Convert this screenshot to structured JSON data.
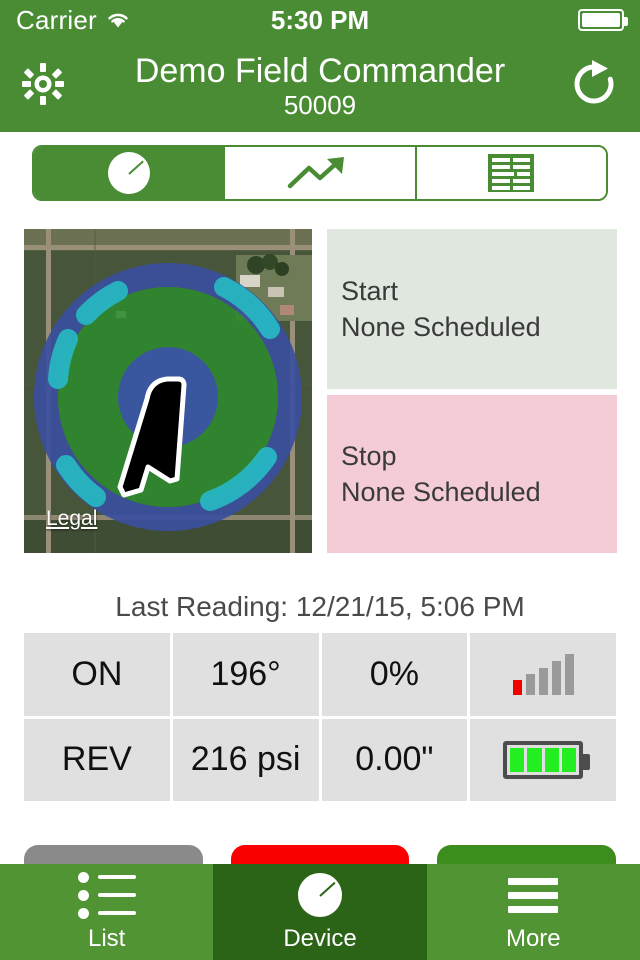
{
  "status_bar": {
    "carrier": "Carrier",
    "time": "5:30 PM",
    "wifi_icon": "wifi-icon",
    "battery_icon": "battery-full-icon"
  },
  "navbar": {
    "settings_icon": "gear-icon",
    "title": "Demo Field Commander",
    "subtitle": "50009",
    "refresh_icon": "refresh-icon"
  },
  "segmented_control": {
    "tabs": [
      {
        "name": "gauge",
        "icon": "gauge-icon",
        "selected": true
      },
      {
        "name": "trend",
        "icon": "trend-arrow-icon",
        "selected": false
      },
      {
        "name": "table",
        "icon": "table-icon",
        "selected": false
      }
    ]
  },
  "map": {
    "legal_label": "Legal",
    "overlay": {
      "outer_ring_color": "#3b4fa0",
      "field_color": "#2e8a2e",
      "inner_circle_color": "#3b52a8",
      "arc_color": "#27b6c2",
      "pivot_arm_color": "#000000",
      "pivot_arm_outline": "#ffffff"
    }
  },
  "schedule": {
    "start": {
      "title": "Start",
      "value": "None Scheduled",
      "bg_color": "#dfe7df"
    },
    "stop": {
      "title": "Stop",
      "value": "None Scheduled",
      "bg_color": "#f3ccd6"
    }
  },
  "last_reading": "Last Reading: 12/21/15, 5:06 PM",
  "status_table": {
    "rows": [
      [
        {
          "type": "text",
          "value": "ON"
        },
        {
          "type": "text",
          "value": "196°"
        },
        {
          "type": "text",
          "value": "0%"
        },
        {
          "type": "icon",
          "value": "signal-strength-icon"
        }
      ],
      [
        {
          "type": "text",
          "value": "REV"
        },
        {
          "type": "text",
          "value": "216 psi"
        },
        {
          "type": "text",
          "value": "0.00\""
        },
        {
          "type": "icon",
          "value": "battery-level-icon"
        }
      ]
    ],
    "signal": {
      "bars": 5,
      "filled": 1,
      "filled_color": "#f00000",
      "empty_color": "#9a9a9a"
    },
    "battery": {
      "cells": 4,
      "filled": 4,
      "fill_color": "#22ee22"
    }
  },
  "action_buttons": [
    {
      "name": "gray-action-button",
      "label": "",
      "color": "#8a8a8a"
    },
    {
      "name": "red-action-button",
      "label": "",
      "color": "#fb0000"
    },
    {
      "name": "green-action-button",
      "label": "",
      "color": "#3d8c1e"
    }
  ],
  "tab_bar": {
    "items": [
      {
        "label": "List",
        "icon": "list-icon",
        "selected": false
      },
      {
        "label": "Device",
        "icon": "gauge-icon",
        "selected": true
      },
      {
        "label": "More",
        "icon": "hamburger-icon",
        "selected": false
      }
    ]
  },
  "colors": {
    "brand_green": "#4a8c34",
    "tabbar_green": "#519433",
    "tab_selected_green": "#2b6317",
    "cell_gray": "#e0e0e0"
  }
}
